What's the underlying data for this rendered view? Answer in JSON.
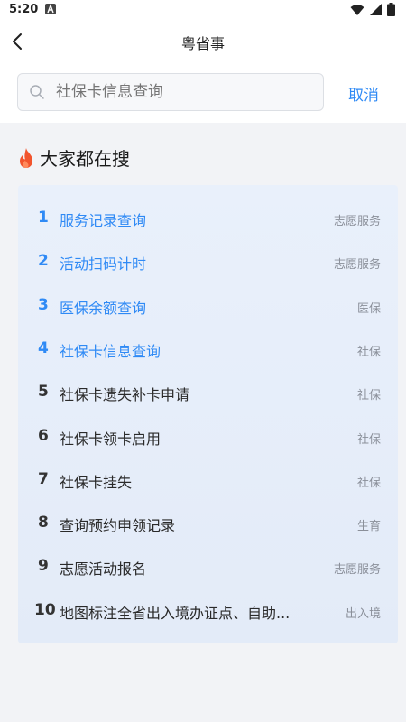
{
  "status_bar": {
    "time": "5:20",
    "notif_icon": "a-letter-notification-icon",
    "wifi_icon": "wifi-icon",
    "signal_icon": "cell-signal-icon",
    "battery_icon": "battery-icon"
  },
  "nav": {
    "title": "粤省事",
    "back_icon": "chevron-left-icon"
  },
  "search": {
    "placeholder": "社保卡信息查询",
    "value": "",
    "cancel_label": "取消"
  },
  "hot_section": {
    "title": "大家都在搜",
    "icon": "fire-icon",
    "accent_color": "#2f8af5",
    "items": [
      {
        "rank": "1",
        "title": "服务记录查询",
        "category": "志愿服务"
      },
      {
        "rank": "2",
        "title": "活动扫码计时",
        "category": "志愿服务"
      },
      {
        "rank": "3",
        "title": "医保余额查询",
        "category": "医保"
      },
      {
        "rank": "4",
        "title": "社保卡信息查询",
        "category": "社保"
      },
      {
        "rank": "5",
        "title": "社保卡遗失补卡申请",
        "category": "社保"
      },
      {
        "rank": "6",
        "title": "社保卡领卡启用",
        "category": "社保"
      },
      {
        "rank": "7",
        "title": "社保卡挂失",
        "category": "社保"
      },
      {
        "rank": "8",
        "title": "查询预约申领记录",
        "category": "生育"
      },
      {
        "rank": "9",
        "title": "志愿活动报名",
        "category": "志愿服务"
      },
      {
        "rank": "10",
        "title": "地图标注全省出入境办证点、自助...",
        "category": "出入境"
      }
    ]
  }
}
